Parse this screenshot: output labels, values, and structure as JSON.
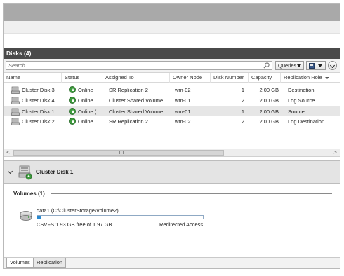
{
  "disks_panel": {
    "title": "Disks (4)",
    "search_placeholder": "Search",
    "queries_label": "Queries",
    "columns": [
      "Name",
      "Status",
      "Assigned To",
      "Owner Node",
      "Disk Number",
      "Capacity",
      "Replication Role"
    ],
    "rows": [
      {
        "name": "Cluster Disk 3",
        "status": "Online",
        "assigned_to": "SR Replication 2",
        "owner_node": "wm-02",
        "disk_number": "1",
        "capacity": "2.00 GB",
        "replication_role": "Destination",
        "selected": false
      },
      {
        "name": "Cluster Disk 4",
        "status": "Online",
        "assigned_to": "Cluster Shared Volume",
        "owner_node": "wm-01",
        "disk_number": "2",
        "capacity": "2.00 GB",
        "replication_role": "Log Source",
        "selected": false
      },
      {
        "name": "Cluster Disk 1",
        "status": "Online (...",
        "assigned_to": "Cluster Shared Volume",
        "owner_node": "wm-01",
        "disk_number": "1",
        "capacity": "2.00 GB",
        "replication_role": "Source",
        "selected": true
      },
      {
        "name": "Cluster Disk 2",
        "status": "Online",
        "assigned_to": "SR Replication 2",
        "owner_node": "wm-02",
        "disk_number": "2",
        "capacity": "2.00 GB",
        "replication_role": "Log Destination",
        "selected": false
      }
    ],
    "scroll_left": "<",
    "scroll_right": ">"
  },
  "detail": {
    "title": "Cluster Disk 1",
    "volumes_header": "Volumes (1)",
    "volume": {
      "name": "data1 (C:\\ClusterStorage\\Volume2)",
      "free_text": "CSVFS 1.93 GB free of 1.97 GB",
      "status": "Redirected Access",
      "used_fraction": 0.02
    },
    "tabs": [
      "Volumes",
      "Replication"
    ],
    "active_tab": 0
  },
  "colors": {
    "title_bar": "#4a4a4a",
    "online_green": "#3d9b3d",
    "volume_bar": "#2a8ad0"
  }
}
